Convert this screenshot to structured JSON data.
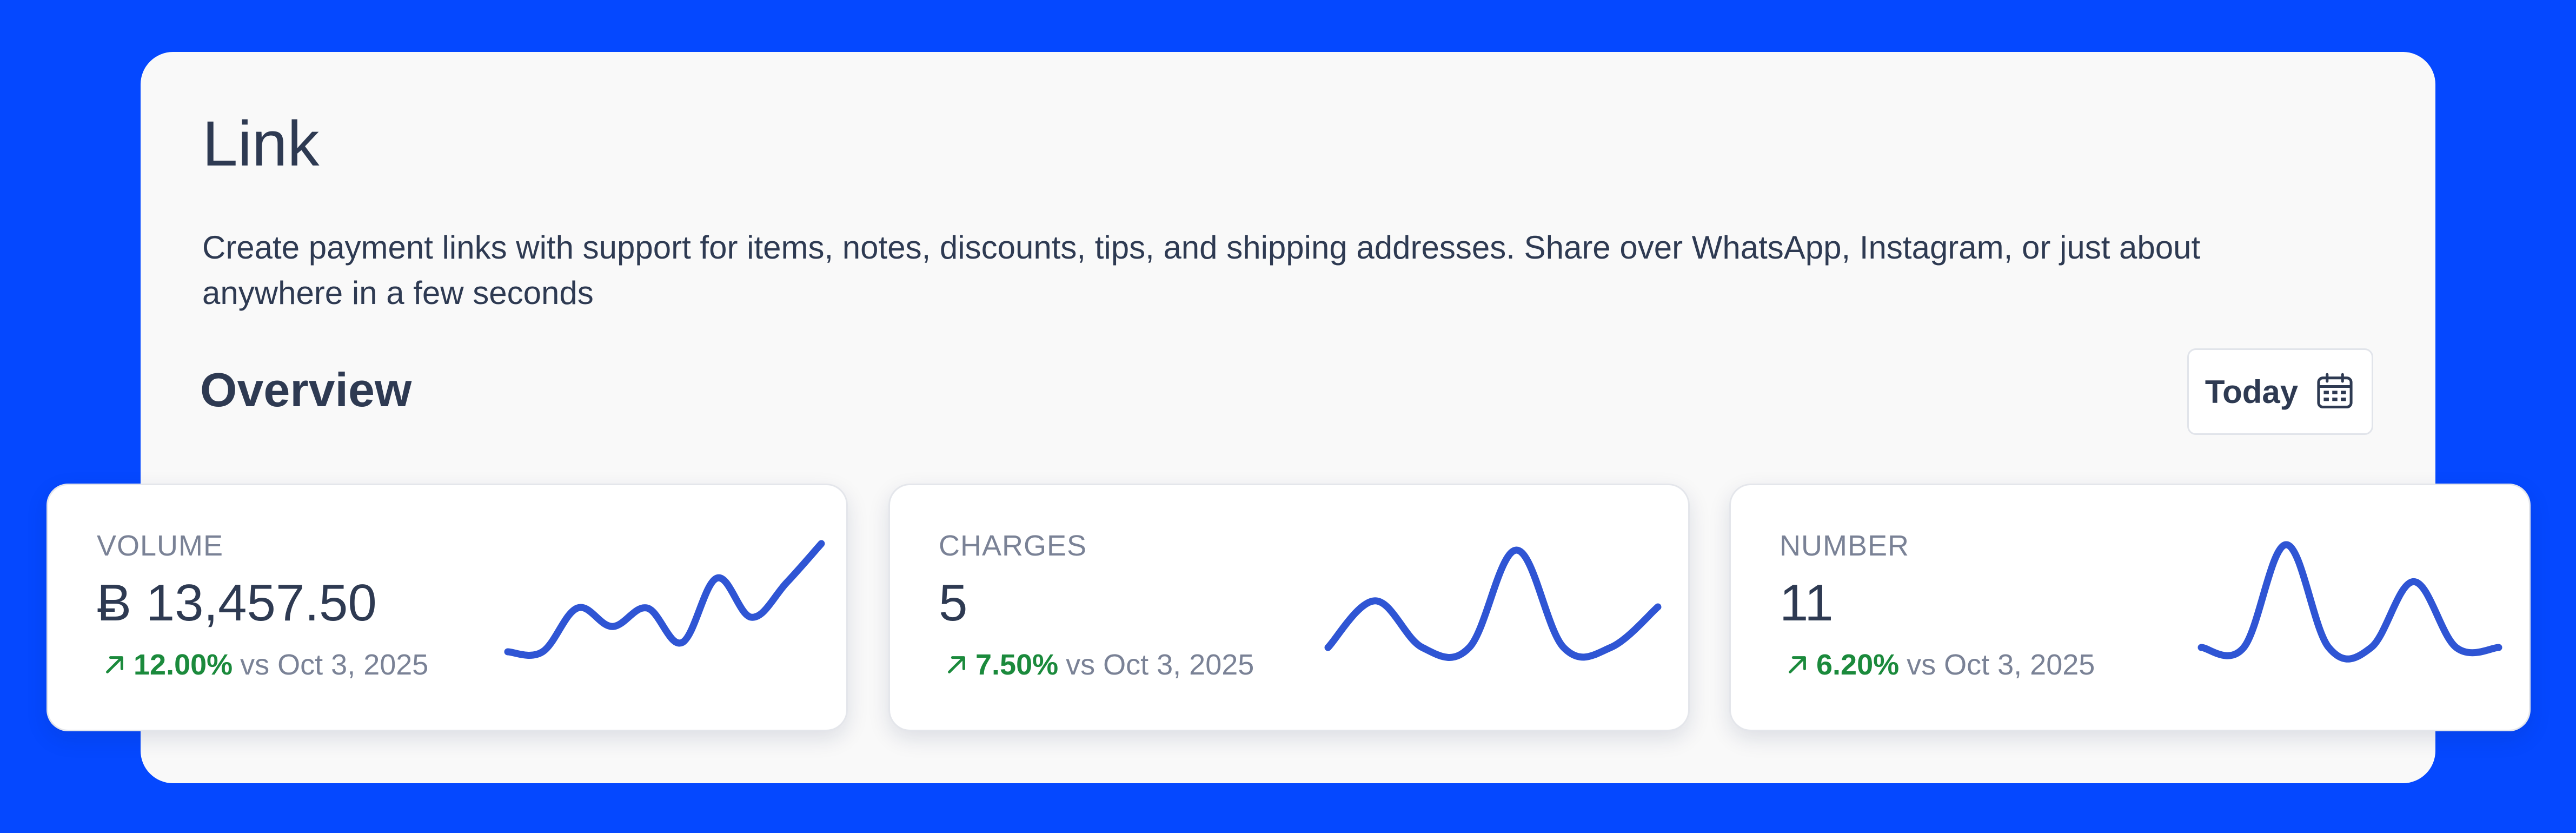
{
  "header": {
    "title": "Link",
    "description": "Create payment links with support for items, notes, discounts, tips, and shipping addresses. Share over WhatsApp, Instagram, or just about anywhere in a few seconds"
  },
  "overview": {
    "title": "Overview",
    "date_filter": {
      "label": "Today",
      "icon": "calendar-icon"
    }
  },
  "metrics": [
    {
      "label": "VOLUME",
      "value": "Ƀ 13,457.50",
      "change": "12.00%",
      "compare": "vs Oct 3, 2025",
      "trend": "up",
      "sparkline": [
        0,
        0,
        38,
        22,
        38,
        8,
        64,
        30,
        60,
        94
      ]
    },
    {
      "label": "CHARGES",
      "value": "5",
      "change": "7.50%",
      "compare": "vs Oct 3, 2025",
      "trend": "up",
      "sparkline": [
        0,
        46,
        0,
        0,
        96,
        0,
        0,
        40
      ]
    },
    {
      "label": "NUMBER",
      "value": "11",
      "change": "6.20%",
      "compare": "vs Oct 3, 2025",
      "trend": "up",
      "sparkline": [
        0,
        0,
        100,
        0,
        0,
        64,
        0,
        0
      ]
    }
  ],
  "colors": {
    "background": "#0548FF",
    "panel": "#F9F9F9",
    "text": "#2E3A52",
    "muted": "#7A8296",
    "positive": "#1B8A3C",
    "sparkline": "#2F55D4"
  }
}
